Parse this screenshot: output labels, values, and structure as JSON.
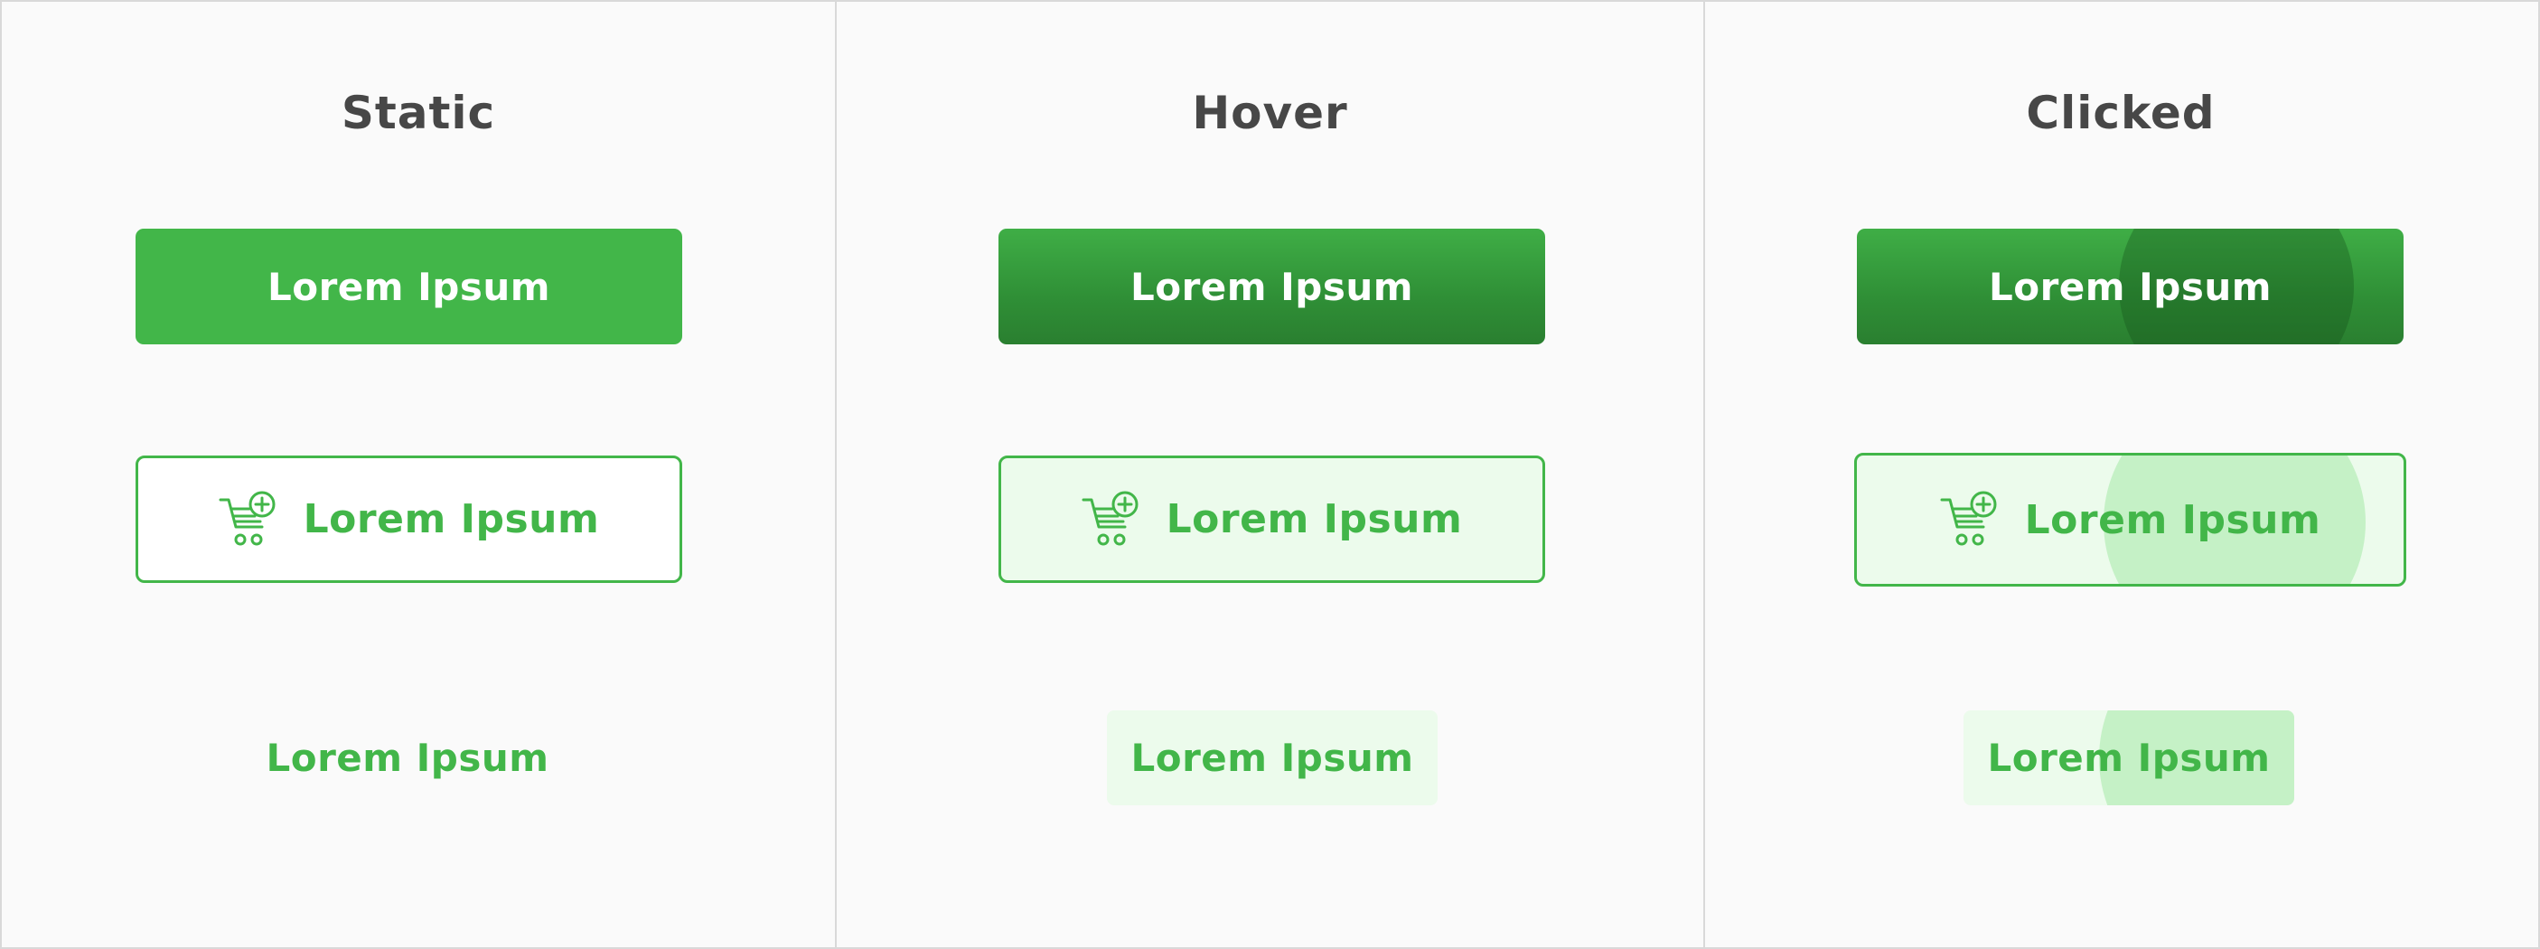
{
  "columns": [
    {
      "title": "Static"
    },
    {
      "title": "Hover"
    },
    {
      "title": "Clicked"
    }
  ],
  "buttons": {
    "primary_label": "Lorem Ipsum",
    "outline_label": "Lorem Ipsum",
    "text_label": "Lorem Ipsum",
    "outline_icon": "cart-add-icon"
  },
  "colors": {
    "accent": "#42b649",
    "accent_dark": "#2a7f30",
    "hover_fill": "#ecfbec",
    "ripple_fill": "#c5f1c6",
    "title_text": "#474747",
    "background": "#fafafa",
    "divider": "#d9d9d9"
  }
}
